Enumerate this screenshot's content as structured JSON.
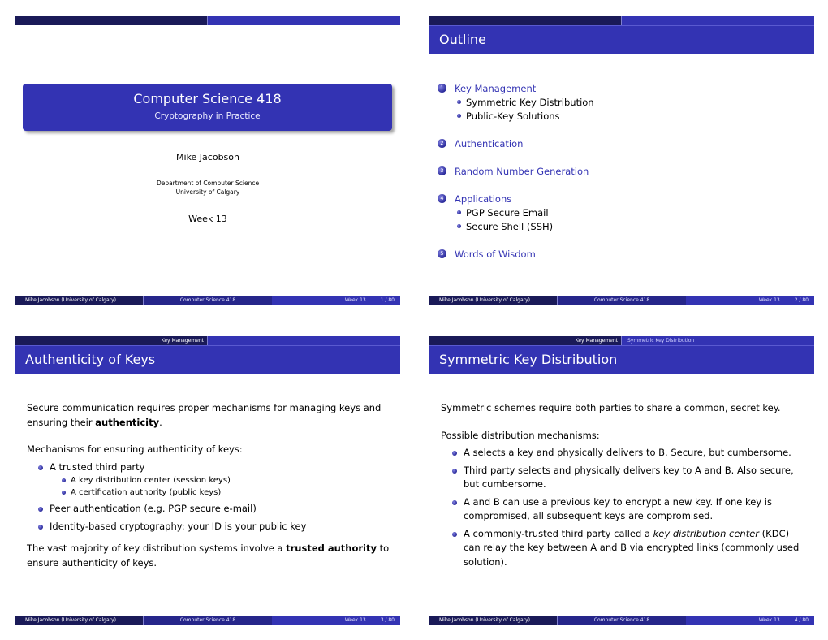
{
  "colors": {
    "navy": "#1a1a58",
    "accent": "#3333b3",
    "text": "#000000"
  },
  "footer": {
    "author": "Mike Jacobson  (University of Calgary)",
    "course": "Computer Science 418",
    "week": "Week 13",
    "total_pages": "80"
  },
  "slides": [
    {
      "page": "1 / 80",
      "title": "Computer Science 418",
      "subtitle": "Cryptography in Practice",
      "author": "Mike Jacobson",
      "department": "Department of Computer Science",
      "university": "University of Calgary",
      "date": "Week 13"
    },
    {
      "page": "2 / 80",
      "frame_title": "Outline",
      "toc": [
        {
          "num": "1",
          "label": "Key Management",
          "subsections": [
            "Symmetric Key Distribution",
            "Public-Key Solutions"
          ]
        },
        {
          "num": "2",
          "label": "Authentication",
          "subsections": []
        },
        {
          "num": "3",
          "label": "Random Number Generation",
          "subsections": []
        },
        {
          "num": "4",
          "label": "Applications",
          "subsections": [
            "PGP Secure Email",
            "Secure Shell (SSH)"
          ]
        },
        {
          "num": "5",
          "label": "Words of Wisdom",
          "subsections": []
        }
      ]
    },
    {
      "page": "3 / 80",
      "nav_section": "Key Management",
      "nav_subsection": "",
      "frame_title": "Authenticity of Keys",
      "para1_pre": "Secure communication requires proper mechanisms for managing keys and ensuring their ",
      "para1_bold": "authenticity",
      "para1_post": ".",
      "para2": "Mechanisms for ensuring authenticity of keys:",
      "items": [
        {
          "text": "A trusted third party",
          "subitems": [
            "A key distribution center (session keys)",
            "A certification authority (public keys)"
          ]
        },
        {
          "text": "Peer authentication (e.g. PGP secure e-mail)"
        },
        {
          "text": "Identity-based cryptography: your ID is your public key"
        }
      ],
      "para3_pre": "The vast majority of key distribution systems involve a ",
      "para3_bold": "trusted authority",
      "para3_post": " to ensure authenticity of keys."
    },
    {
      "page": "4 / 80",
      "nav_section": "Key Management",
      "nav_subsection": "Symmetric Key Distribution",
      "frame_title": "Symmetric Key Distribution",
      "para1": "Symmetric schemes require both parties to share a common, secret key.",
      "para2": "Possible distribution mechanisms:",
      "items": [
        "A selects a key and physically delivers to B. Secure, but cumbersome.",
        "Third party selects and physically delivers key to A and B. Also secure, but cumbersome.",
        "A and B can use a previous key to encrypt a new key. If one key is compromised, all subsequent keys are compromised."
      ],
      "item4_pre": "A commonly-trusted third party called a ",
      "item4_italic": "key distribution center",
      "item4_post": " (KDC) can relay the key between A and B via encrypted links (commonly used solution)."
    }
  ]
}
